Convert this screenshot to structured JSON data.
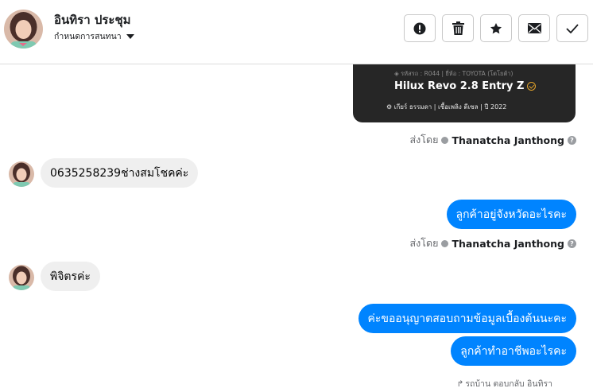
{
  "header": {
    "name": "อินทิรา ประชุม",
    "subtitle": "กำหนดการสนทนา"
  },
  "actions": [
    {
      "icon": "alert-icon"
    },
    {
      "icon": "trash-icon"
    },
    {
      "icon": "star-icon"
    },
    {
      "icon": "mail-icon"
    },
    {
      "icon": "check-icon"
    }
  ],
  "card": {
    "meta": "รหัสรถ : R044 | ยี่ห้อ : TOYOTA (โตโยต้า)",
    "model": "Hilux Revo 2.8 Entry Z",
    "specs": "เกียร์ ธรรมดา   |   เชื้อเพลิง ดีเซล   |   ปี 2022"
  },
  "messages": {
    "sent_by_label": "ส่งโดย",
    "sender": "Thanatcha Janthong",
    "in_1": "0635258239ช่างสมโชคค่ะ",
    "out_1": "ลูกค้าอยู่จังหวัดอะไรคะ",
    "in_2": "พิจิตรค่ะ",
    "out_2": "ค่ะขออนุญาตสอบถามข้อมูลเบื้องต้นนะคะ",
    "out_3": "ลูกค้าทำอาชีพอะไรคะ",
    "reply_note": "รถบ้าน ตอบกลับ อินทิรา"
  },
  "colors": {
    "accent": "#0084ff",
    "incoming_bubble": "#efefef",
    "card_bg": "#262626"
  }
}
